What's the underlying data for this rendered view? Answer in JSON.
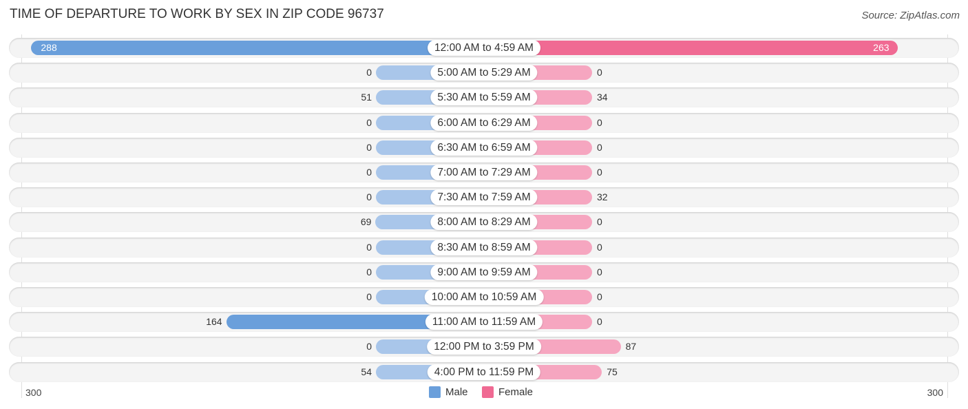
{
  "header": {
    "title": "TIME OF DEPARTURE TO WORK BY SEX IN ZIP CODE 96737",
    "source": "Source: ZipAtlas.com"
  },
  "colors": {
    "male": "#a9c6ea",
    "male_strong": "#6a9fdb",
    "female": "#f6a6c0",
    "female_strong": "#f06a93"
  },
  "chart_data": {
    "type": "bar",
    "orientation": "horizontal-diverging",
    "title": "TIME OF DEPARTURE TO WORK BY SEX IN ZIP CODE 96737",
    "categories": [
      "12:00 AM to 4:59 AM",
      "5:00 AM to 5:29 AM",
      "5:30 AM to 5:59 AM",
      "6:00 AM to 6:29 AM",
      "6:30 AM to 6:59 AM",
      "7:00 AM to 7:29 AM",
      "7:30 AM to 7:59 AM",
      "8:00 AM to 8:29 AM",
      "8:30 AM to 8:59 AM",
      "9:00 AM to 9:59 AM",
      "10:00 AM to 10:59 AM",
      "11:00 AM to 11:59 AM",
      "12:00 PM to 3:59 PM",
      "4:00 PM to 11:59 PM"
    ],
    "series": [
      {
        "name": "Male",
        "values": [
          288,
          0,
          51,
          0,
          0,
          0,
          0,
          69,
          0,
          0,
          0,
          164,
          0,
          54
        ]
      },
      {
        "name": "Female",
        "values": [
          263,
          0,
          34,
          0,
          0,
          0,
          32,
          0,
          0,
          0,
          0,
          0,
          87,
          75
        ]
      }
    ],
    "axis": {
      "left_label": "300",
      "right_label": "300",
      "range": [
        0,
        300
      ]
    },
    "legend": {
      "position": "bottom-center",
      "entries": [
        "Male",
        "Female"
      ]
    }
  }
}
